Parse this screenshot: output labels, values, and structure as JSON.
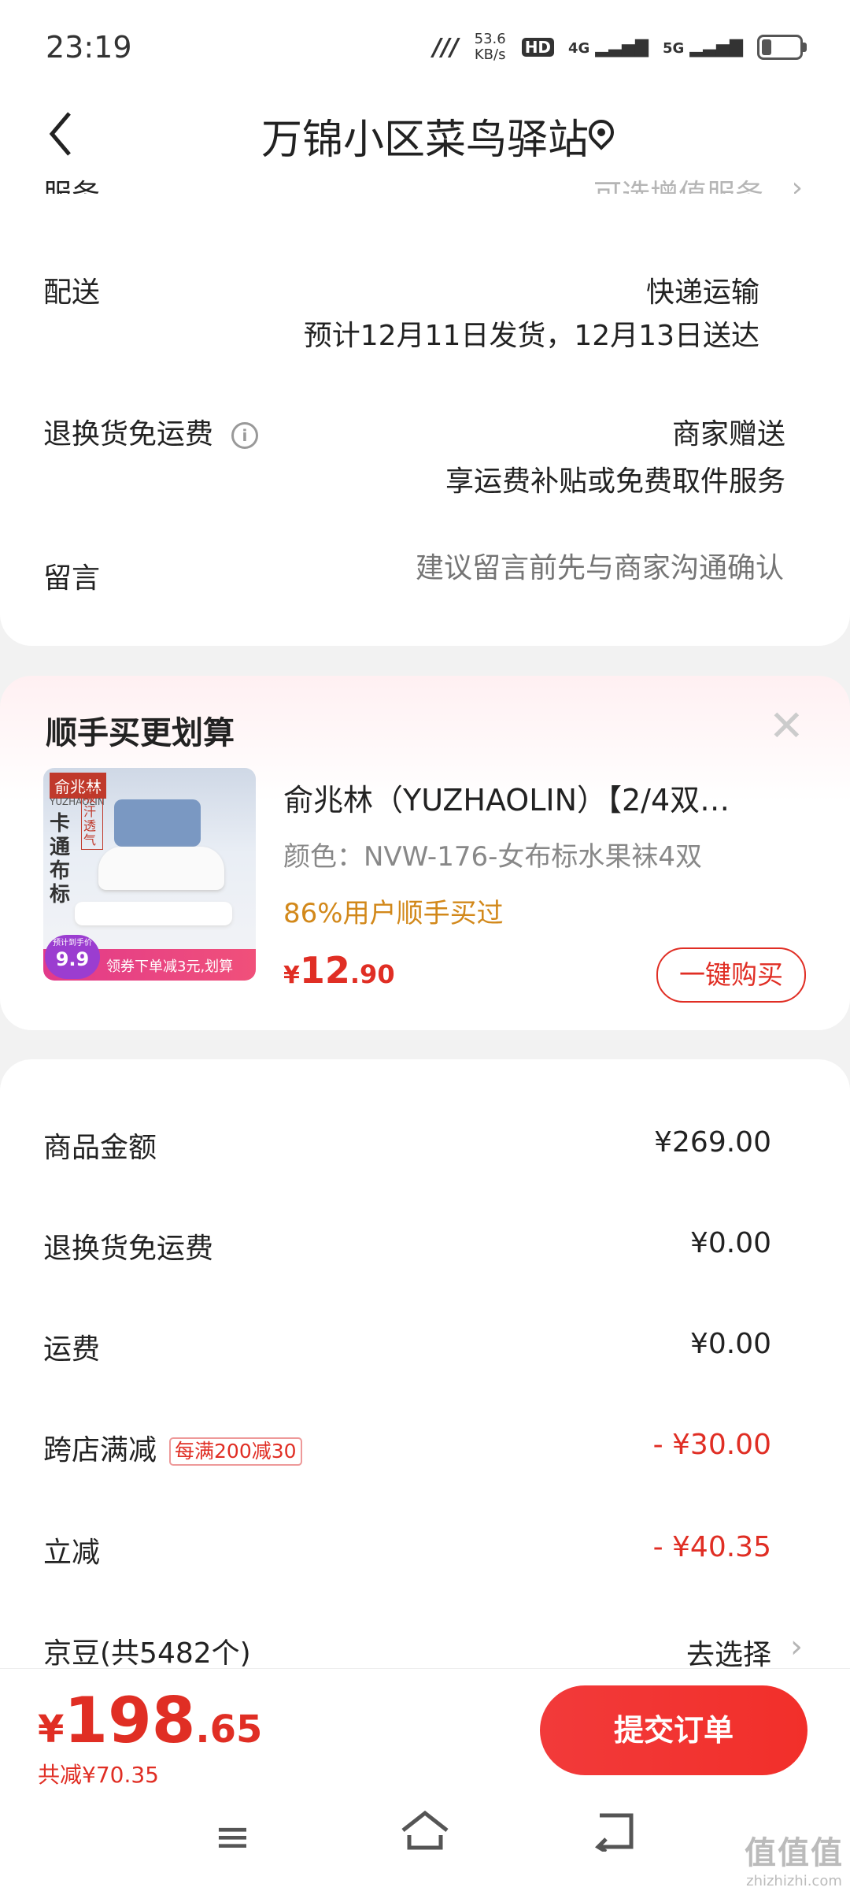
{
  "status": {
    "time": "23:19",
    "net_speed": "53.6 KB/s",
    "hd": "HD",
    "sim1": "1",
    "sim2": "2",
    "g4": "4G",
    "g5": "5G"
  },
  "header": {
    "title": "万锦小区菜鸟驿站"
  },
  "order": {
    "service_label": "服务",
    "service_value": "可选增值服务",
    "delivery_label": "配送",
    "delivery_method": "快递运输",
    "delivery_eta": "预计12月11日发货，12月13日送达",
    "return_label": "退换货免运费",
    "return_value": "商家赠送",
    "return_desc": "享运费补贴或免费取件服务",
    "message_label": "留言",
    "message_placeholder": "建议留言前先与商家沟通确认"
  },
  "addon": {
    "title": "顺手买更划算",
    "product_name": "俞兆林（YUZHAOLIN）【2/4双…",
    "spec": "颜色：NVW-176-女布标水果袜4双",
    "popularity": "86%用户顺手买过",
    "price_symbol": "¥",
    "price_int": "12",
    "price_dec": ".90",
    "buy_label": "一键购买",
    "img_brand": "俞兆林",
    "img_brand_en": "YUZHAOLIN",
    "img_tag": "卡通布标",
    "img_side": "吸汗透气",
    "img_badge_small": "预计到手价",
    "img_badge_price": "9.9",
    "img_banner": "领券下单减3元,划算"
  },
  "summary": {
    "goods_label": "商品金额",
    "goods_value": "¥269.00",
    "return_label": "退换货免运费",
    "return_value": "¥0.00",
    "shipping_label": "运费",
    "shipping_value": "¥0.00",
    "cross_label": "跨店满减",
    "cross_tag": "每满200减30",
    "cross_value": "- ¥30.00",
    "instant_label": "立减",
    "instant_value": "- ¥40.35",
    "beans_label": "京豆(共5482个)",
    "beans_action": "去选择"
  },
  "footer": {
    "total_symbol": "¥",
    "total_int": "198",
    "total_dec": ".65",
    "saved": "共减¥70.35",
    "submit_label": "提交订单"
  },
  "watermark": {
    "logo": "值值值",
    "url": "zhizhizhi.com"
  },
  "colors": {
    "accent": "#e02e24",
    "highlight": "#d2881a"
  }
}
